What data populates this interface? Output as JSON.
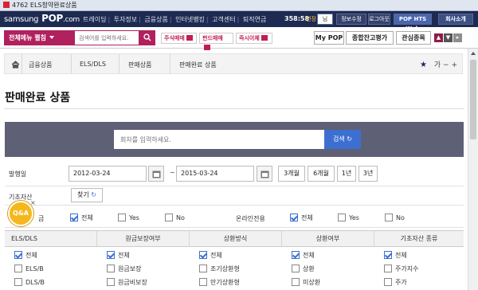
{
  "window": {
    "title": "4762 ELS청약완료상품"
  },
  "topnav": {
    "logo_a": "samsung",
    "logo_b": "POP",
    "logo_c": ".com",
    "menu": [
      "트레이딩",
      "투자정보",
      "금융상품",
      "인터넷뱅킹",
      "고객센터",
      "퇴직연금"
    ],
    "clock": "358:58",
    "extend": "연장",
    "user_suffix": "님",
    "info_edit": "정보수정",
    "logout": "로그아웃",
    "pop_hts": "POP HTS Web",
    "company": "회사소개"
  },
  "menubar": {
    "all_menu": "전체메뉴 펼침",
    "search_placeholder": "검색어를 입력하세요.",
    "quick": [
      "주식매매",
      "펀드매매",
      "즉시이체"
    ],
    "my_pop": "My POP",
    "balance": "종합잔고평가",
    "watch": "관심종목",
    "side": [
      "▲",
      "▼",
      "▸"
    ]
  },
  "breadcrumb": {
    "items": [
      "금융상품",
      "ELS/DLS",
      "판매상품",
      "판매완료 상품"
    ],
    "font_label": "가",
    "minus": "−",
    "plus": "+"
  },
  "page": {
    "title": "판매완료 상품"
  },
  "search": {
    "placeholder": "회차를 입력하세요.",
    "button": "검색"
  },
  "filters": {
    "issue_label": "발행일",
    "date_from": "2012-03-24",
    "tilde": "~",
    "date_to": "2015-03-24",
    "periods": [
      "3개월",
      "6개월",
      "1년",
      "3년"
    ],
    "underlying_label": "기초자산",
    "find": "찾기",
    "row3_label": "금",
    "row3_opts": [
      "전체",
      "Yes",
      "No"
    ],
    "online_label": "온라인전용",
    "online_opts": [
      "전체",
      "Yes",
      "No"
    ]
  },
  "grid": {
    "headers": [
      "ELS/DLS",
      "원금보장여부",
      "상환방식",
      "상환여부",
      "기초자산 종류"
    ],
    "columns": [
      [
        "전체",
        "ELS/B",
        "DLS/B"
      ],
      [
        "전체",
        "원금보장",
        "원금비보장"
      ],
      [
        "전체",
        "조기상환형",
        "만기상환형"
      ],
      [
        "전체",
        "상환",
        "미상환"
      ],
      [
        "전체",
        "주가지수",
        "주가"
      ]
    ]
  },
  "qa": {
    "label": "Q&A",
    "close": "×"
  }
}
